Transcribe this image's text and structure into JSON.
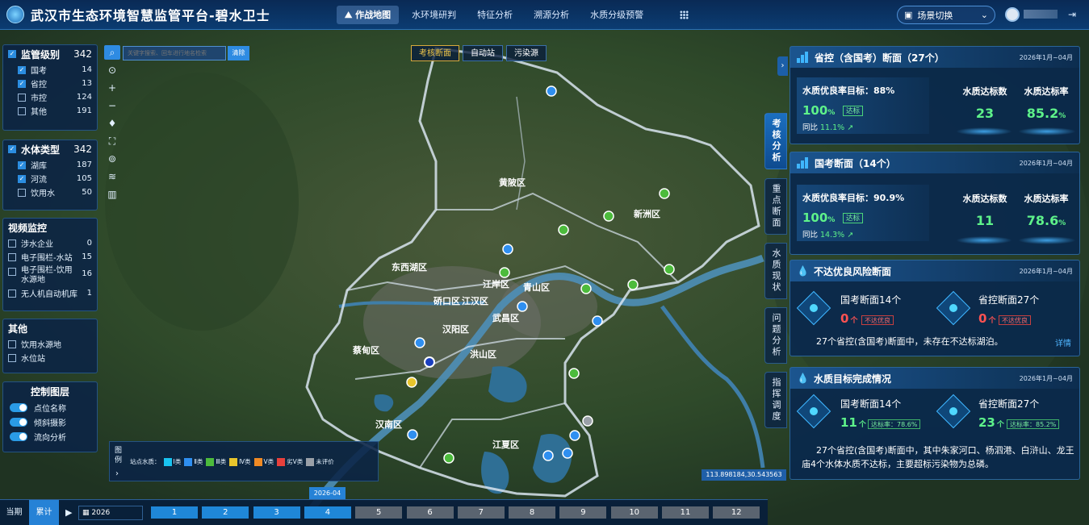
{
  "app": {
    "title": "武汉市生态环境智慧监管平台-碧水卫士"
  },
  "nav": {
    "items": [
      "作战地图",
      "水环境研判",
      "特征分析",
      "溯源分析",
      "水质分级预警"
    ]
  },
  "header": {
    "scene_switch": "场景切换",
    "user_name": "",
    "logout": "⇥"
  },
  "filters": {
    "supervision": {
      "title": "监管级别",
      "count": "342",
      "items": [
        {
          "label": "国考",
          "count": "14",
          "checked": true
        },
        {
          "label": "省控",
          "count": "13",
          "checked": true
        },
        {
          "label": "市控",
          "count": "124",
          "checked": false
        },
        {
          "label": "其他",
          "count": "191",
          "checked": false
        }
      ]
    },
    "waterbody": {
      "title": "水体类型",
      "count": "342",
      "items": [
        {
          "label": "湖库",
          "count": "187",
          "checked": true
        },
        {
          "label": "河流",
          "count": "105",
          "checked": true
        },
        {
          "label": "饮用水",
          "count": "50",
          "checked": false
        }
      ]
    },
    "video": {
      "title": "视频监控",
      "items": [
        {
          "label": "涉水企业",
          "count": "0"
        },
        {
          "label": "电子围栏-水站",
          "count": "15"
        },
        {
          "label": "电子围栏-饮用水源地",
          "count": "16"
        },
        {
          "label": "无人机自动机库",
          "count": "1"
        }
      ]
    },
    "other": {
      "title": "其他",
      "items": [
        {
          "label": "饮用水源地"
        },
        {
          "label": "水位站"
        }
      ]
    },
    "layers": {
      "title": "控制图层",
      "items": [
        {
          "label": "点位名称"
        },
        {
          "label": "倾斜摄影"
        },
        {
          "label": "流向分析"
        }
      ]
    }
  },
  "search": {
    "placeholder": "关键字搜索、回车进行地名检索",
    "clear": "清除"
  },
  "map_tabs": [
    "考核断面",
    "自动站",
    "污染源"
  ],
  "map_labels": {
    "districts": [
      "黄陂区",
      "新洲区",
      "东西湖区",
      "江岸区",
      "青山区",
      "硚口区",
      "江汉区",
      "汉阳区",
      "武昌区",
      "洪山区",
      "蔡甸区",
      "汉南区",
      "江夏区"
    ]
  },
  "legend": {
    "title": "图例",
    "prefix": "站点水质：",
    "items": [
      {
        "label": "Ⅰ类",
        "color": "#19c3f0"
      },
      {
        "label": "Ⅱ类",
        "color": "#2f8ff0"
      },
      {
        "label": "Ⅲ类",
        "color": "#4cbb3c"
      },
      {
        "label": "Ⅳ类",
        "color": "#e8c52c"
      },
      {
        "label": "Ⅴ类",
        "color": "#f08a24"
      },
      {
        "label": "劣Ⅴ类",
        "color": "#e8403c"
      },
      {
        "label": "未评价",
        "color": "#9aa0a8"
      }
    ]
  },
  "side_tabs": [
    "考核分析",
    "重点断面",
    "水质现状",
    "问题分析",
    "指挥调度"
  ],
  "cards": {
    "prov": {
      "title": "省控（含国考）断面（27个）",
      "date": "2026年1月~04月",
      "target_label": "水质优良率目标：88%",
      "target_value": "100",
      "target_unit": "%",
      "target_badge": "达标",
      "yoy_label": "同比",
      "yoy_value": "11.1%",
      "count_label": "水质达标数",
      "count_value": "23",
      "rate_label": "水质达标率",
      "rate_value": "85.2",
      "rate_unit": "%"
    },
    "nat": {
      "title": "国考断面（14个）",
      "date": "2026年1月~04月",
      "target_label": "水质优良率目标：90.9%",
      "target_value": "100",
      "target_unit": "%",
      "target_badge": "达标",
      "yoy_label": "同比",
      "yoy_value": "14.3%",
      "count_label": "水质达标数",
      "count_value": "11",
      "rate_label": "水质达标率",
      "rate_value": "78.6",
      "rate_unit": "%"
    },
    "risk": {
      "title": "不达优良风险断面",
      "date": "2026年1月~04月",
      "left_label": "国考断面14个",
      "left_value": "0",
      "left_unit": "个",
      "left_badge": "不达优良",
      "right_label": "省控断面27个",
      "right_value": "0",
      "right_unit": "个",
      "right_badge": "不达优良",
      "summary": "27个省控(含国考)断面中，未存在不达标湖泊。",
      "detail": "详情"
    },
    "goal": {
      "title": "水质目标完成情况",
      "date": "2026年1月~04月",
      "left_label": "国考断面14个",
      "left_value": "11",
      "left_unit": "个",
      "left_badge": "达标率：78.6%",
      "right_label": "省控断面27个",
      "right_value": "23",
      "right_unit": "个",
      "right_badge": "达标率：85.2%",
      "summary": "27个省控(含国考)断面中，其中朱家河口、杨泗港、白浒山、龙王庙4个水体水质不达标，主要超标污染物为总磷。"
    }
  },
  "coords": "113.898184,30.543563",
  "timeline": {
    "tabs": [
      "当期",
      "累计"
    ],
    "active_tab": "累计",
    "year": "2026",
    "months": [
      "1",
      "2",
      "3",
      "4",
      "5",
      "6",
      "7",
      "8",
      "9",
      "10",
      "11",
      "12"
    ],
    "current_month": 4,
    "tooltip": "2026-04"
  },
  "colors": {
    "accent": "#2682d6",
    "good": "#5ef28a",
    "bad": "#ff5252"
  }
}
